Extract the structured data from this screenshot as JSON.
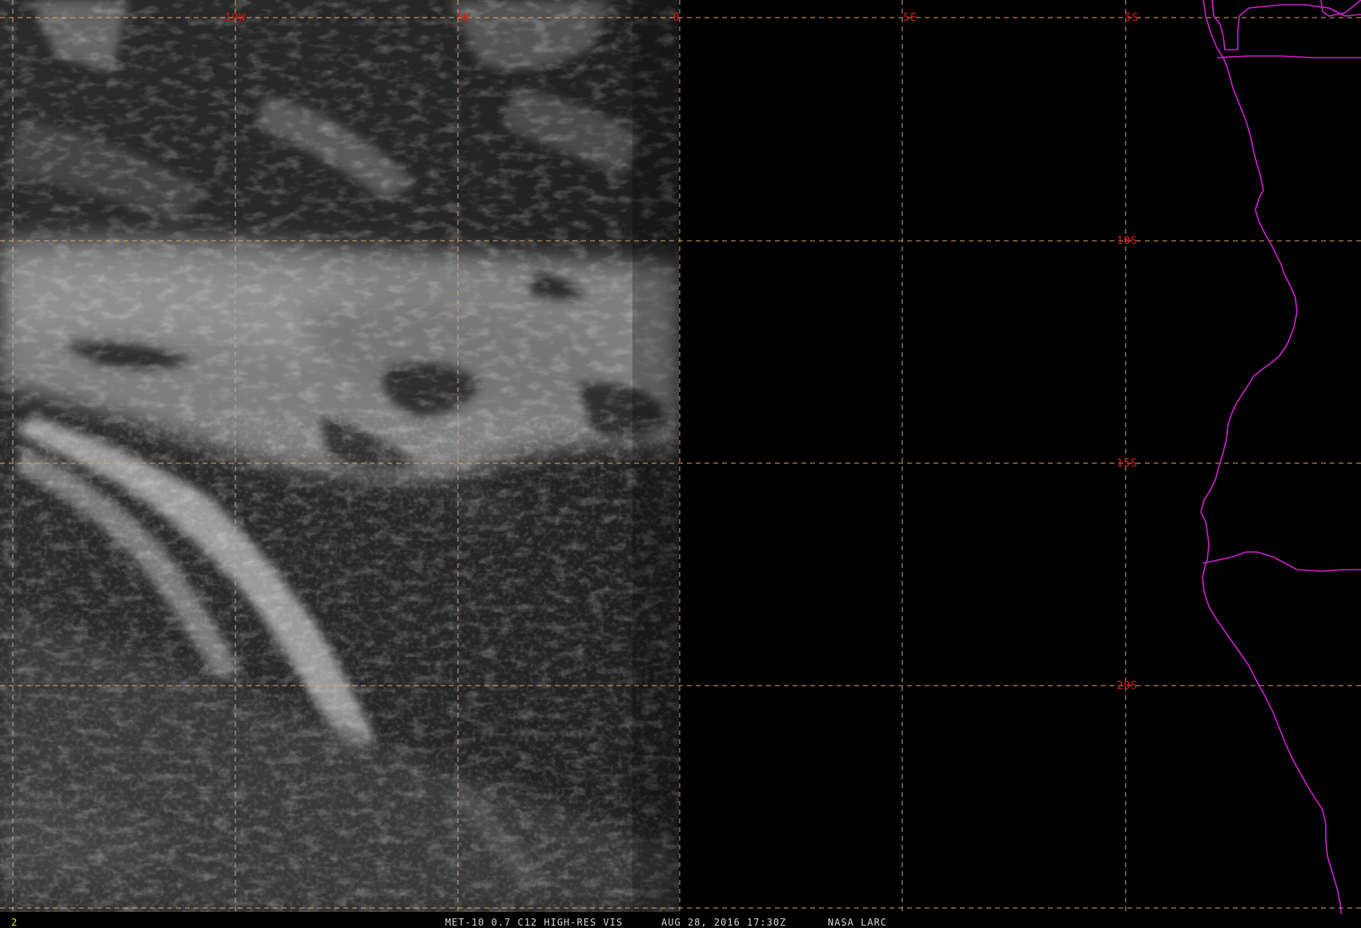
{
  "colors": {
    "background": "#000000",
    "graticule": "#d9a56b",
    "label": "#e01818",
    "coastline": "#d020d0",
    "status_text": "#d8d8d8",
    "frame_number": "#e0e020"
  },
  "graticule": {
    "lon_labels": [
      "10W",
      "5W",
      "0",
      "5E"
    ],
    "lat_labels": [
      "5S",
      "10S",
      "15S",
      "20S"
    ]
  },
  "status_bar": {
    "frame_number": "2",
    "product": "MET-10 0.7 C12 HIGH-RES VIS",
    "datetime": "AUG 28, 2016 17:30Z",
    "source": "NASA LARC"
  }
}
